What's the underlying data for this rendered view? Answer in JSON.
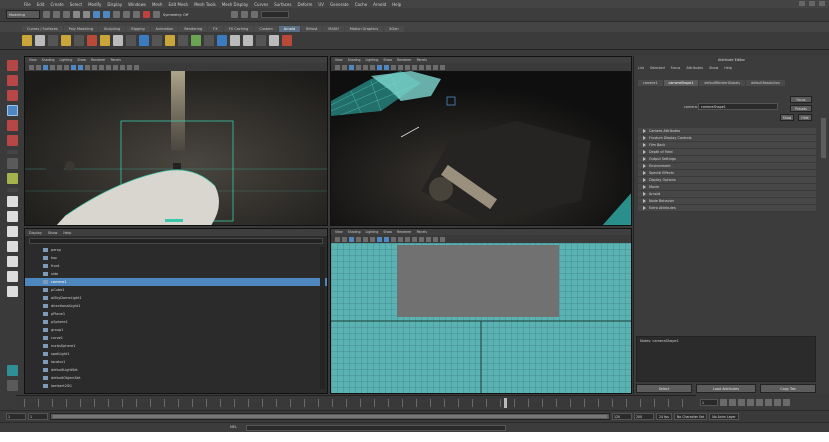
{
  "menubar": {
    "items": [
      "File",
      "Edit",
      "Create",
      "Select",
      "Modify",
      "Display",
      "Windows",
      "Mesh",
      "Edit Mesh",
      "Mesh Tools",
      "Mesh Display",
      "Curves",
      "Surfaces",
      "Deform",
      "UV",
      "Generate",
      "Cache",
      "Arnold",
      "Help"
    ]
  },
  "statusline": {
    "mode": "Modeling",
    "symmetry_label": "Symmetry: Off"
  },
  "shelf": {
    "tabs": [
      "Curves / Surfaces",
      "Poly Modeling",
      "Sculpting",
      "Rigging",
      "Animation",
      "Rendering",
      "FX",
      "FX Caching",
      "Custom",
      "Arnold",
      "Bifrost",
      "MASH",
      "Motion Graphics",
      "XGen"
    ],
    "active_tab": "Arnold"
  },
  "viewports": {
    "menu": [
      "View",
      "Shading",
      "Lighting",
      "Show",
      "Renderer",
      "Panels"
    ]
  },
  "outliner": {
    "menu": [
      "Display",
      "Show",
      "Help"
    ],
    "items": [
      {
        "label": "persp"
      },
      {
        "label": "top"
      },
      {
        "label": "front"
      },
      {
        "label": "side"
      },
      {
        "label": "camera1"
      },
      {
        "label": "pCube1"
      },
      {
        "label": "aiSkyDomeLight1"
      },
      {
        "label": "directionalLight1"
      },
      {
        "label": "pPlane1"
      },
      {
        "label": "pSphere1"
      },
      {
        "label": "group1"
      },
      {
        "label": "curve1"
      },
      {
        "label": "nurbsSphere1"
      },
      {
        "label": "spotLight1"
      },
      {
        "label": "locator1"
      },
      {
        "label": "defaultLightSet"
      },
      {
        "label": "defaultObjectSet"
      },
      {
        "label": "lambert2SG"
      }
    ],
    "selected_index": 4
  },
  "attribute_editor": {
    "title": "Attribute Editor",
    "menu": [
      "List",
      "Selected",
      "Focus",
      "Attributes",
      "Show",
      "Help"
    ],
    "tabs": [
      "camera1",
      "cameraShape1",
      "defaultRenderGlobals",
      "defaultResolution"
    ],
    "active_tab": "cameraShape1",
    "field_label": "camera:",
    "field_value": "cameraShape1",
    "buttons": [
      "Focus",
      "Presets",
      "Show",
      "Hide"
    ],
    "sections": [
      "Camera Attributes",
      "Frustum Display Controls",
      "Film Back",
      "Depth of Field",
      "Output Settings",
      "Environment",
      "Special Effects",
      "Display Options",
      "Movie",
      "Arnold",
      "Node Behavior",
      "Extra Attributes"
    ],
    "notes_label": "Notes: cameraShape1",
    "bottom_buttons": [
      "Select",
      "Load Attributes",
      "Copy Tab"
    ]
  },
  "timeline": {
    "current_frame": "1",
    "range_start": "1",
    "range_inner_start": "1",
    "range_inner_end": "120",
    "range_end": "200",
    "fps": "24 fps",
    "character_set": "No Character Set",
    "anim_layer": "No Anim Layer"
  },
  "cmdline": {
    "label": "MEL"
  }
}
